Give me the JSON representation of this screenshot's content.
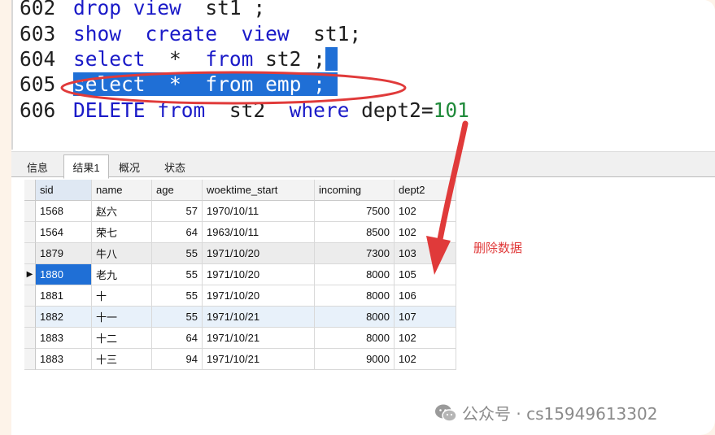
{
  "editor": {
    "lines": [
      {
        "num": "602",
        "parts": [
          "drop",
          "view",
          "st1 ;"
        ]
      },
      {
        "num": "603",
        "parts": [
          "show",
          "create",
          "view",
          "st1;"
        ]
      },
      {
        "num": "604",
        "parts": [
          "select",
          "*",
          "from",
          "st2 ;"
        ]
      },
      {
        "num": "605",
        "parts": [
          "select",
          "*",
          "from",
          "emp ;"
        ]
      },
      {
        "num": "606",
        "parts": [
          "DELETE",
          "from",
          "st2",
          "where",
          "dept2=",
          "101"
        ]
      }
    ]
  },
  "tabs": [
    "信息",
    "结果1",
    "概况",
    "状态"
  ],
  "table": {
    "columns": [
      "sid",
      "name",
      "age",
      "woektime_start",
      "incoming",
      "dept2"
    ],
    "rows": [
      [
        "1568",
        "赵六",
        "57",
        "1970/10/11",
        "7500",
        "102"
      ],
      [
        "1564",
        "荣七",
        "64",
        "1963/10/11",
        "8500",
        "102"
      ],
      [
        "1879",
        "牛八",
        "55",
        "1971/10/20",
        "7300",
        "103"
      ],
      [
        "1880",
        "老九",
        "55",
        "1971/10/20",
        "8000",
        "105"
      ],
      [
        "1881",
        "十",
        "55",
        "1971/10/20",
        "8000",
        "106"
      ],
      [
        "1882",
        "十一",
        "55",
        "1971/10/21",
        "8000",
        "107"
      ],
      [
        "1883",
        "十二",
        "64",
        "1971/10/21",
        "8000",
        "102"
      ],
      [
        "1883",
        "十三",
        "94",
        "1971/10/21",
        "9000",
        "102"
      ]
    ],
    "current_row_marker": "▶"
  },
  "annotation": {
    "label": "删除数据",
    "color": "#e03a3a"
  },
  "watermark": {
    "text": "公众号 · cs15949613302"
  },
  "colors": {
    "keyword": "#1a1ac8",
    "selection": "#1f6fd6",
    "number": "#1f8a3a"
  }
}
